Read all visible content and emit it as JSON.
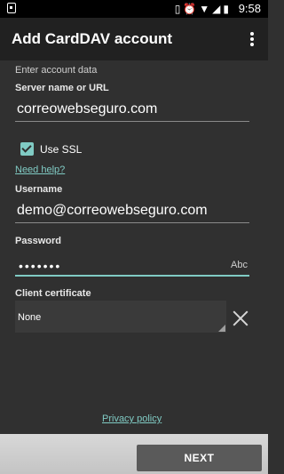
{
  "status_bar": {
    "time": "9:58",
    "icons": [
      "vibrate-icon",
      "alarm-icon",
      "wifi-icon",
      "signal-icon",
      "battery-icon"
    ],
    "notification_icon": "notification-icon"
  },
  "app_bar": {
    "title": "Add CardDAV account",
    "overflow_icon": "more-vert-icon"
  },
  "form": {
    "hint": "Enter account data",
    "server": {
      "label": "Server name or URL",
      "value": "correowebseguro.com"
    },
    "ssl": {
      "label": "Use SSL",
      "checked": true
    },
    "help_link": "Need help?",
    "username": {
      "label": "Username",
      "value": "demo@correowebseguro.com"
    },
    "password": {
      "label": "Password",
      "masked_value": "•••••••",
      "toggle_label": "Abc"
    },
    "client_certificate": {
      "label": "Client certificate",
      "selected": "None"
    }
  },
  "privacy_link": "Privacy policy",
  "footer": {
    "next_label": "NEXT"
  },
  "colors": {
    "accent": "#80cbc4",
    "app_bar": "#212121",
    "background": "#303030"
  }
}
